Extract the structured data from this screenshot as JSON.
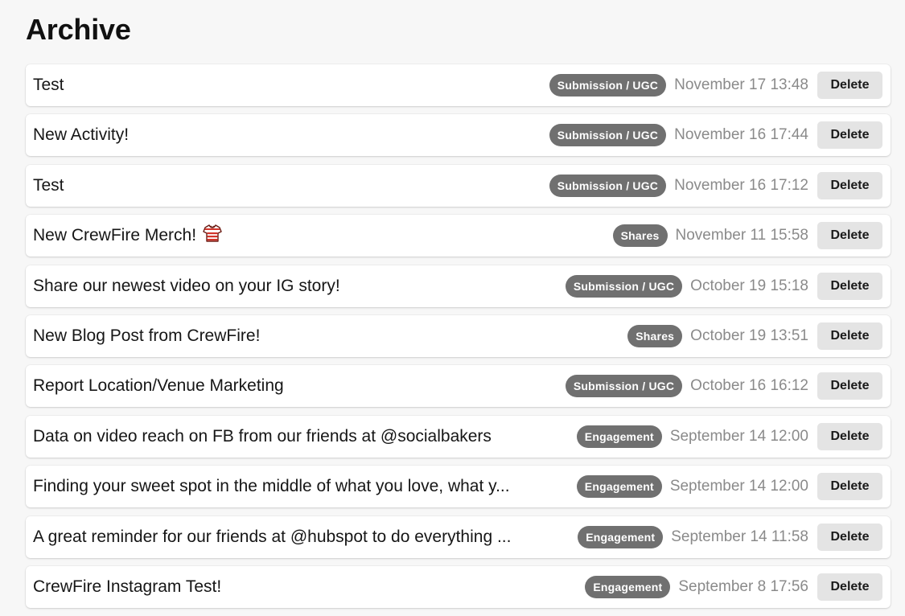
{
  "page": {
    "title": "Archive"
  },
  "colors": {
    "background": "#f7f7f7",
    "tag_background": "#707070",
    "tag_text": "#ffffff",
    "date_text": "#8a8a8a",
    "delete_button_background": "#e4e4e4"
  },
  "archive": {
    "delete_label": "Delete",
    "items": [
      {
        "title": "Test",
        "tag": "Submission / UGC",
        "date": "November 17 13:48"
      },
      {
        "title": "New Activity!",
        "tag": "Submission / UGC",
        "date": "November 16 17:44"
      },
      {
        "title": "Test",
        "tag": "Submission / UGC",
        "date": "November 16 17:12"
      },
      {
        "title": "New CrewFire Merch!",
        "icon": "t-shirt-icon",
        "tag": "Shares",
        "date": "November 11 15:58"
      },
      {
        "title": "Share our newest video on your IG story!",
        "tag": "Submission / UGC",
        "date": "October 19 15:18"
      },
      {
        "title": "New Blog Post from CrewFire!",
        "tag": "Shares",
        "date": "October 19 13:51"
      },
      {
        "title": "Report Location/Venue Marketing",
        "tag": "Submission / UGC",
        "date": "October 16 16:12"
      },
      {
        "title": "Data on video reach on FB from our friends at @socialbakers",
        "tag": "Engagement",
        "date": "September 14 12:00"
      },
      {
        "title": "Finding your sweet spot in the middle of what you love, what y...",
        "tag": "Engagement",
        "date": "September 14 12:00"
      },
      {
        "title": "A great reminder for our friends at @hubspot to do everything ...",
        "tag": "Engagement",
        "date": "September 14 11:58"
      },
      {
        "title": "CrewFire Instagram Test!",
        "tag": "Engagement",
        "date": "September 8 17:56"
      }
    ]
  }
}
